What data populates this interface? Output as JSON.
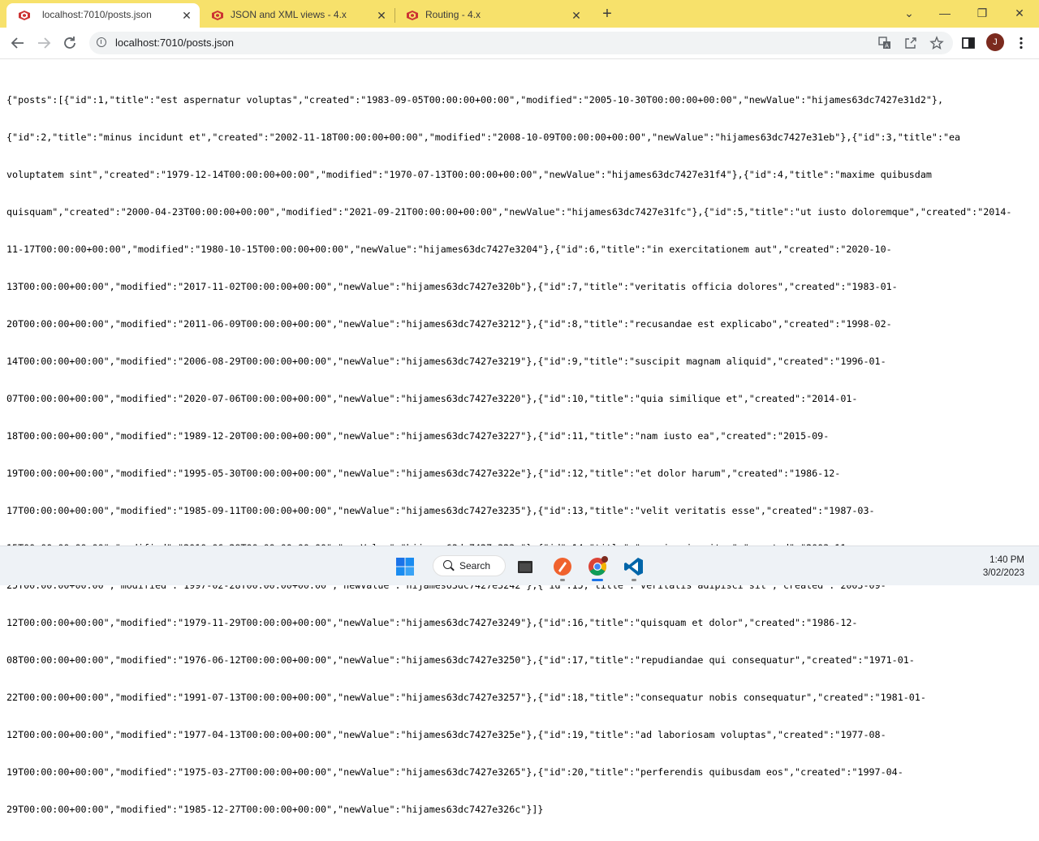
{
  "browser": {
    "tabs": [
      {
        "label": "localhost:7010/posts.json",
        "active": true
      },
      {
        "label": "JSON and XML views - 4.x",
        "active": false
      },
      {
        "label": "Routing - 4.x",
        "active": false
      }
    ],
    "new_tab_symbol": "+",
    "window_controls": {
      "minimize": "—",
      "restore": "❐",
      "close": "✕",
      "tab_search": "⌄"
    },
    "url": "localhost:7010/posts.json",
    "profile_initial": "J",
    "icons": [
      "back-arrow-icon",
      "forward-arrow-icon",
      "reload-icon",
      "info-icon",
      "translate-icon",
      "share-icon",
      "star-icon",
      "side-panel-icon",
      "menu-icon"
    ],
    "theme_color": "#f7e16b",
    "favicon_color": "#cc3333"
  },
  "page": {
    "lines": [
      "{\"posts\":[{\"id\":1,\"title\":\"est aspernatur voluptas\",\"created\":\"1983-09-05T00:00:00+00:00\",\"modified\":\"2005-10-30T00:00:00+00:00\",\"newValue\":\"hijames63dc7427e31d2\"},",
      "{\"id\":2,\"title\":\"minus incidunt et\",\"created\":\"2002-11-18T00:00:00+00:00\",\"modified\":\"2008-10-09T00:00:00+00:00\",\"newValue\":\"hijames63dc7427e31eb\"},{\"id\":3,\"title\":\"ea",
      "voluptatem sint\",\"created\":\"1979-12-14T00:00:00+00:00\",\"modified\":\"1970-07-13T00:00:00+00:00\",\"newValue\":\"hijames63dc7427e31f4\"},{\"id\":4,\"title\":\"maxime quibusdam",
      "quisquam\",\"created\":\"2000-04-23T00:00:00+00:00\",\"modified\":\"2021-09-21T00:00:00+00:00\",\"newValue\":\"hijames63dc7427e31fc\"},{\"id\":5,\"title\":\"ut iusto doloremque\",\"created\":\"2014-",
      "11-17T00:00:00+00:00\",\"modified\":\"1980-10-15T00:00:00+00:00\",\"newValue\":\"hijames63dc7427e3204\"},{\"id\":6,\"title\":\"in exercitationem aut\",\"created\":\"2020-10-",
      "13T00:00:00+00:00\",\"modified\":\"2017-11-02T00:00:00+00:00\",\"newValue\":\"hijames63dc7427e320b\"},{\"id\":7,\"title\":\"veritatis officia dolores\",\"created\":\"1983-01-",
      "20T00:00:00+00:00\",\"modified\":\"2011-06-09T00:00:00+00:00\",\"newValue\":\"hijames63dc7427e3212\"},{\"id\":8,\"title\":\"recusandae est explicabo\",\"created\":\"1998-02-",
      "14T00:00:00+00:00\",\"modified\":\"2006-08-29T00:00:00+00:00\",\"newValue\":\"hijames63dc7427e3219\"},{\"id\":9,\"title\":\"suscipit magnam aliquid\",\"created\":\"1996-01-",
      "07T00:00:00+00:00\",\"modified\":\"2020-07-06T00:00:00+00:00\",\"newValue\":\"hijames63dc7427e3220\"},{\"id\":10,\"title\":\"quia similique et\",\"created\":\"2014-01-",
      "18T00:00:00+00:00\",\"modified\":\"1989-12-20T00:00:00+00:00\",\"newValue\":\"hijames63dc7427e3227\"},{\"id\":11,\"title\":\"nam iusto ea\",\"created\":\"2015-09-",
      "19T00:00:00+00:00\",\"modified\":\"1995-05-30T00:00:00+00:00\",\"newValue\":\"hijames63dc7427e322e\"},{\"id\":12,\"title\":\"et dolor harum\",\"created\":\"1986-12-",
      "17T00:00:00+00:00\",\"modified\":\"1985-09-11T00:00:00+00:00\",\"newValue\":\"hijames63dc7427e3235\"},{\"id\":13,\"title\":\"velit veritatis esse\",\"created\":\"1987-03-",
      "15T00:00:00+00:00\",\"modified\":\"2010-06-29T00:00:00+00:00\",\"newValue\":\"hijames63dc7427e323c\"},{\"id\":14,\"title\":\"sequi quia vitae\",\"created\":\"2003-11-",
      "25T00:00:00+00:00\",\"modified\":\"1997-02-28T00:00:00+00:00\",\"newValue\":\"hijames63dc7427e3242\"},{\"id\":15,\"title\":\"veritatis adipisci sit\",\"created\":\"2003-09-",
      "12T00:00:00+00:00\",\"modified\":\"1979-11-29T00:00:00+00:00\",\"newValue\":\"hijames63dc7427e3249\"},{\"id\":16,\"title\":\"quisquam et dolor\",\"created\":\"1986-12-",
      "08T00:00:00+00:00\",\"modified\":\"1976-06-12T00:00:00+00:00\",\"newValue\":\"hijames63dc7427e3250\"},{\"id\":17,\"title\":\"repudiandae qui consequatur\",\"created\":\"1971-01-",
      "22T00:00:00+00:00\",\"modified\":\"1991-07-13T00:00:00+00:00\",\"newValue\":\"hijames63dc7427e3257\"},{\"id\":18,\"title\":\"consequatur nobis consequatur\",\"created\":\"1981-01-",
      "12T00:00:00+00:00\",\"modified\":\"1977-04-13T00:00:00+00:00\",\"newValue\":\"hijames63dc7427e325e\"},{\"id\":19,\"title\":\"ad laboriosam voluptas\",\"created\":\"1977-08-",
      "19T00:00:00+00:00\",\"modified\":\"1975-03-27T00:00:00+00:00\",\"newValue\":\"hijames63dc7427e3265\"},{\"id\":20,\"title\":\"perferendis quibusdam eos\",\"created\":\"1997-04-",
      "29T00:00:00+00:00\",\"modified\":\"1985-12-27T00:00:00+00:00\",\"newValue\":\"hijames63dc7427e326c\"}]}"
    ]
  },
  "taskbar": {
    "search_label": "Search",
    "time": "1:40 PM",
    "date": "3/02/2023",
    "apps": [
      "windows-start-icon",
      "file-explorer-icon",
      "browser-app-icon",
      "chrome-icon",
      "vscode-icon"
    ]
  }
}
